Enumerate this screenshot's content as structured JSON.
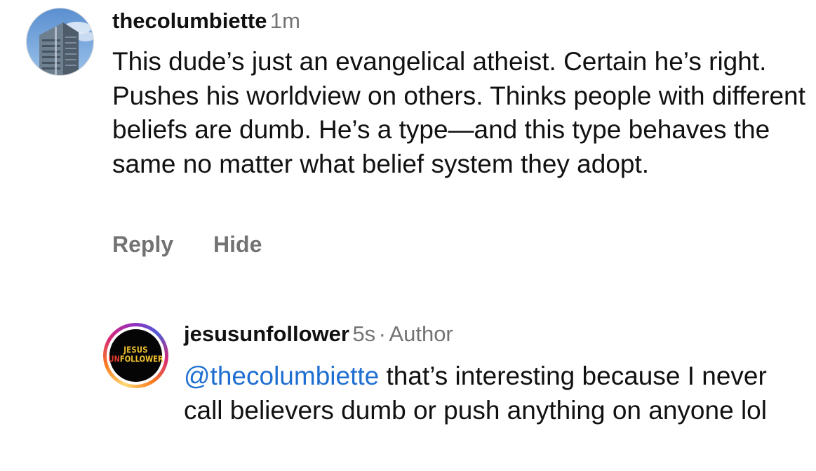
{
  "comments": [
    {
      "username": "thecolumbiette",
      "time": "1m",
      "text": "This dude’s just an evangelical atheist. Certain he’s right. Pushes his worldview on others. Thinks people with different beliefs are dumb. He’s a type—and this type behaves the same no matter what belief system they adopt.",
      "actions": {
        "reply": "Reply",
        "hide": "Hide"
      },
      "avatar_icon": "building-photo-icon"
    },
    {
      "username": "jesusunfollower",
      "time": "5s",
      "separator": "·",
      "badge": "Author",
      "mention": "@thecolumbiette",
      "text": " that’s interesting because I never call believers dumb or push anything on anyone lol",
      "avatar_logo": {
        "line1": "JESUS",
        "un": "UN",
        "rest": "FOLLOWER"
      },
      "avatar_ring": "story-ring-gradient"
    }
  ],
  "colors": {
    "text": "#111111",
    "secondary": "#737373",
    "mention": "#1f6fd1",
    "logo_yellow": "#f4c430",
    "logo_red": "#e03a2f"
  }
}
